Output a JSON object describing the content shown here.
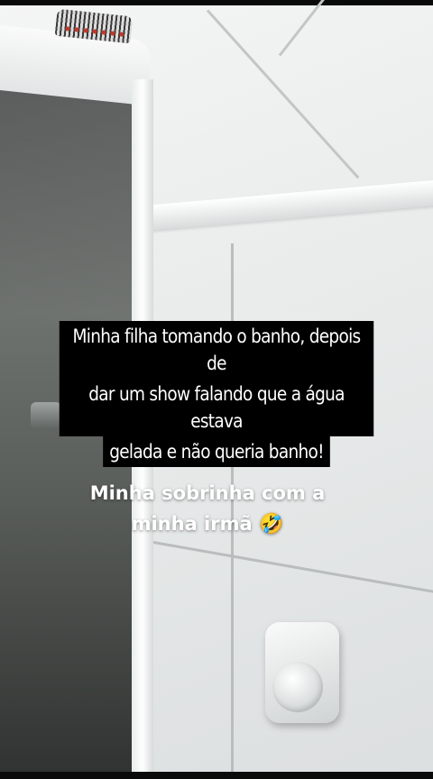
{
  "captions": {
    "main": {
      "lines": [
        "Minha filha tomando o banho, depois de",
        "dar um show falando que a água estava",
        "gelada e não queria banho!"
      ]
    },
    "sub": {
      "line1": "Minha sobrinha com a",
      "line2": "minha irmã",
      "emoji": "🤣"
    }
  },
  "scene": {
    "description_icons": [
      "shower-glass",
      "hair-brush",
      "wall-tiles",
      "flush-button"
    ]
  }
}
